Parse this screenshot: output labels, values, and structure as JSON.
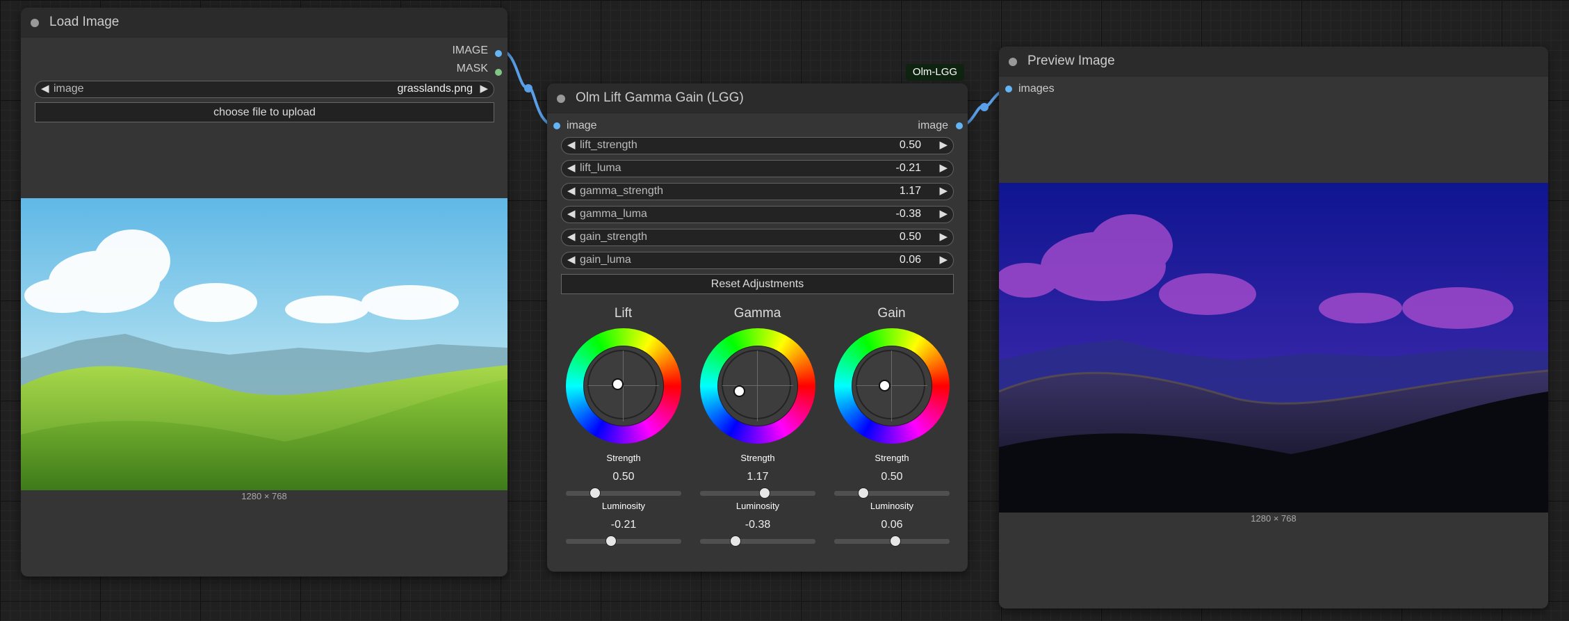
{
  "load_node": {
    "title": "Load Image",
    "outputs": [
      {
        "label": "IMAGE",
        "color": "#64b5f6"
      },
      {
        "label": "MASK",
        "color": "#81c784"
      }
    ],
    "image_widget": {
      "label": "image",
      "value": "grasslands.png"
    },
    "upload_button": "choose file to upload",
    "dimensions": "1280 × 768",
    "picture": "green grassy hills under a blue sky with white clouds"
  },
  "lgg_node": {
    "badge": "Olm-LGG",
    "title": "Olm Lift Gamma Gain (LGG)",
    "input_label": "image",
    "output_label": "image",
    "widgets": [
      {
        "label": "lift_strength",
        "value": "0.50"
      },
      {
        "label": "lift_luma",
        "value": "-0.21"
      },
      {
        "label": "gamma_strength",
        "value": "1.17"
      },
      {
        "label": "gamma_luma",
        "value": "-0.38"
      },
      {
        "label": "gain_strength",
        "value": "0.50"
      },
      {
        "label": "gain_luma",
        "value": "0.06"
      }
    ],
    "reset_button": "Reset Adjustments",
    "wheels": [
      {
        "title": "Lift",
        "handle_x": -0.15,
        "handle_y": 0.05,
        "strength_label": "Strength",
        "strength_value": "0.50",
        "strength_fraction": 0.25,
        "luminosity_label": "Luminosity",
        "luminosity_value": "-0.21",
        "luminosity_fraction": 0.39
      },
      {
        "title": "Gamma",
        "handle_x": -0.48,
        "handle_y": -0.13,
        "strength_label": "Strength",
        "strength_value": "1.17",
        "strength_fraction": 0.56,
        "luminosity_label": "Luminosity",
        "luminosity_value": "-0.38",
        "luminosity_fraction": 0.31
      },
      {
        "title": "Gain",
        "handle_x": -0.2,
        "handle_y": 0.02,
        "strength_label": "Strength",
        "strength_value": "0.50",
        "strength_fraction": 0.25,
        "luminosity_label": "Luminosity",
        "luminosity_value": "0.06",
        "luminosity_fraction": 0.53
      }
    ]
  },
  "preview_node": {
    "title": "Preview Image",
    "input_label": "images",
    "dimensions": "1280 × 768",
    "picture": "the same landscape color graded to deep blue and purple tones"
  },
  "colors": {
    "image_link": "#5aa0e8",
    "mask_slot": "#81c784"
  }
}
